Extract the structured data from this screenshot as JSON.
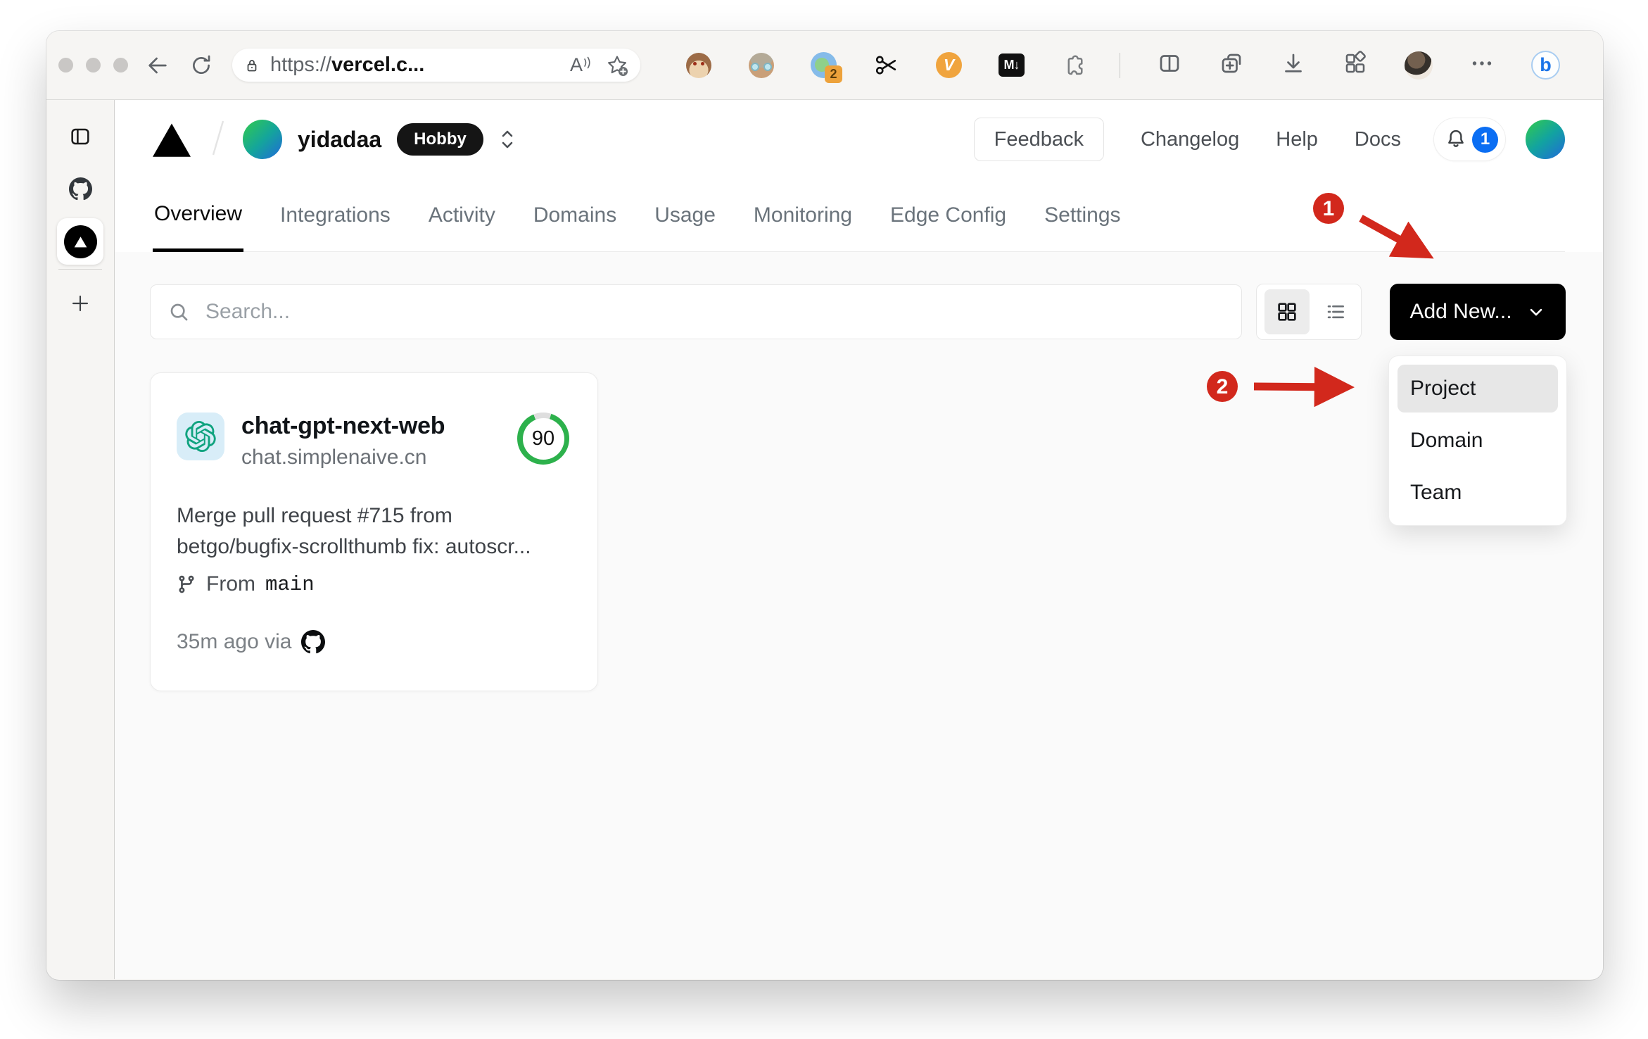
{
  "browser": {
    "url_scheme": "https://",
    "url_domain": "vercel.c...",
    "reader_label": "A",
    "extension_badge": "2",
    "v_extension_label": "V",
    "markdown_extension_label": "M↓",
    "bing_label": "b"
  },
  "vercel_header": {
    "team_name": "yidadaa",
    "plan_badge": "Hobby",
    "nav": {
      "feedback": "Feedback",
      "changelog": "Changelog",
      "help": "Help",
      "docs": "Docs"
    },
    "notification_count": "1"
  },
  "tabs": [
    {
      "label": "Overview",
      "active": true
    },
    {
      "label": "Integrations"
    },
    {
      "label": "Activity"
    },
    {
      "label": "Domains"
    },
    {
      "label": "Usage"
    },
    {
      "label": "Monitoring"
    },
    {
      "label": "Edge Config"
    },
    {
      "label": "Settings"
    }
  ],
  "controls": {
    "search_placeholder": "Search...",
    "add_new_label": "Add New..."
  },
  "dropdown": {
    "items": [
      "Project",
      "Domain",
      "Team"
    ],
    "highlighted": "Project"
  },
  "project_card": {
    "name": "chat-gpt-next-web",
    "domain": "chat.simplenaive.cn",
    "score": "90",
    "commit_line1": "Merge pull request #715 from",
    "commit_line2": "betgo/bugfix-scrollthumb fix: autoscr...",
    "from_label": "From",
    "branch": "main",
    "meta": "35m ago via"
  },
  "annotations": {
    "step1": "1",
    "step2": "2"
  },
  "colors": {
    "annotation_red": "#d2281c",
    "score_green": "#2db14c",
    "notification_blue": "#0b6ef3",
    "openai_teal": "#10a37f",
    "add_new_black": "#000000"
  }
}
